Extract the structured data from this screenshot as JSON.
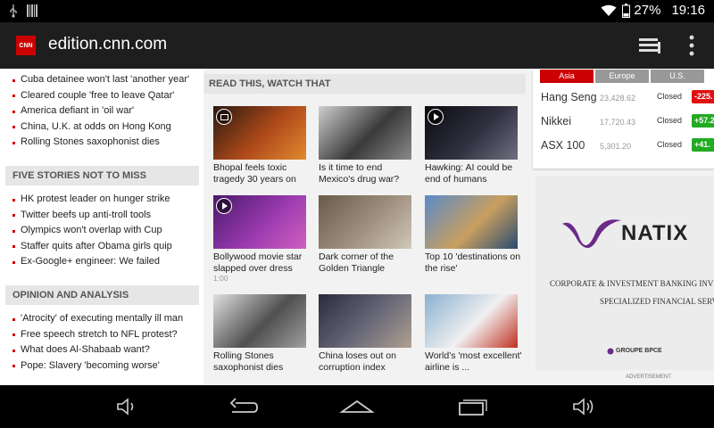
{
  "status_bar": {
    "battery": "27%",
    "time": "19:16",
    "icons": [
      "usb-icon",
      "barcode-icon",
      "wifi-icon",
      "battery-icon"
    ]
  },
  "app_bar": {
    "logo_text": "CNN",
    "url": "edition.cnn.com",
    "icons": [
      "tabs-icon",
      "overflow-menu-icon"
    ]
  },
  "left_column": {
    "top_stories": [
      "Cuba detainee won't last 'another year'",
      "Cleared couple 'free to leave Qatar'",
      "America defiant in 'oil war'",
      "China, U.K. at odds on Hong Kong",
      "Rolling Stones saxophonist dies"
    ],
    "section2_title": "FIVE STORIES NOT TO MISS",
    "section2_items": [
      "HK protest leader on hunger strike",
      "Twitter beefs up anti-troll tools",
      "Olympics won't overlap with Cup",
      "Staffer quits after Obama girls quip",
      "Ex-Google+ engineer: We failed"
    ],
    "section3_title": "OPINION AND ANALYSIS",
    "section3_items": [
      "'Atrocity' of executing mentally ill man",
      "Free speech stretch to NFL protest?",
      "What does Al-Shabaab want?",
      "Pope: Slavery 'becoming worse'"
    ]
  },
  "middle_column": {
    "header": "READ THIS, WATCH THAT",
    "stories": [
      {
        "caption": "Bhopal feels toxic tragedy 30 years on",
        "badge": "gallery",
        "duration": "",
        "colors": [
          "#2a1a10",
          "#b04a1a",
          "#e08a30"
        ]
      },
      {
        "caption": "Is it time to end Mexico's drug war?",
        "badge": "",
        "duration": "",
        "colors": [
          "#cfcfcf",
          "#3a3a3a",
          "#8a8a8a"
        ]
      },
      {
        "caption": "Hawking: AI could be end of humans",
        "badge": "video",
        "duration": "",
        "colors": [
          "#0a0a10",
          "#303040",
          "#707080"
        ]
      },
      {
        "caption": "Bollywood movie star slapped over dress",
        "badge": "video",
        "duration": "1:00",
        "colors": [
          "#4a1a6a",
          "#9a3ab0",
          "#d060c0"
        ]
      },
      {
        "caption": "Dark corner of the Golden Triangle",
        "badge": "",
        "duration": "",
        "colors": [
          "#6a5a4a",
          "#a09080",
          "#d0c8b8"
        ]
      },
      {
        "caption": "Top 10 'destinations on the rise'",
        "badge": "",
        "duration": "",
        "colors": [
          "#5a8ac8",
          "#c8a060",
          "#2a4a70"
        ]
      },
      {
        "caption": "Rolling Stones saxophonist dies",
        "badge": "",
        "duration": "",
        "colors": [
          "#e0e0e0",
          "#505050",
          "#a0a0a0"
        ]
      },
      {
        "caption": "China loses out on corruption index",
        "badge": "",
        "duration": "",
        "colors": [
          "#2a2a3a",
          "#6a6a7a",
          "#b0a090"
        ]
      },
      {
        "caption": "World's 'most excellent' airline is ...",
        "badge": "",
        "duration": "",
        "colors": [
          "#8ab0d0",
          "#f0f0f0",
          "#c03020"
        ]
      }
    ]
  },
  "markets": {
    "tabs": [
      "Asia",
      "Europe",
      "U.S."
    ],
    "active_tab": "Asia",
    "rows": [
      {
        "name": "Hang Seng",
        "value": "23,428.62",
        "status": "Closed",
        "change": "-225.",
        "color": "#e01010"
      },
      {
        "name": "Nikkei",
        "value": "17,720.43",
        "status": "Closed",
        "change": "+57.2",
        "color": "#22aa22"
      },
      {
        "name": "ASX 100",
        "value": "5,301.20",
        "status": "Closed",
        "change": "+41.",
        "color": "#22aa22"
      }
    ]
  },
  "ad": {
    "brand": "NATIX",
    "line1": "CORPORATE & INVESTMENT BANKING   INVESTMEN",
    "line2": "SPECIALIZED FINANCIAL SERVICES",
    "group": "GROUPE BPCE",
    "label": "ADVERTISEMENT"
  },
  "nav_bar": {
    "icons": [
      "volume-down-icon",
      "back-icon",
      "home-icon",
      "recent-apps-icon",
      "volume-up-icon"
    ]
  },
  "colors": {
    "accent": "#cc0000",
    "app_bar": "#1e1e1e",
    "section_header_bg": "#e6e6e6"
  }
}
